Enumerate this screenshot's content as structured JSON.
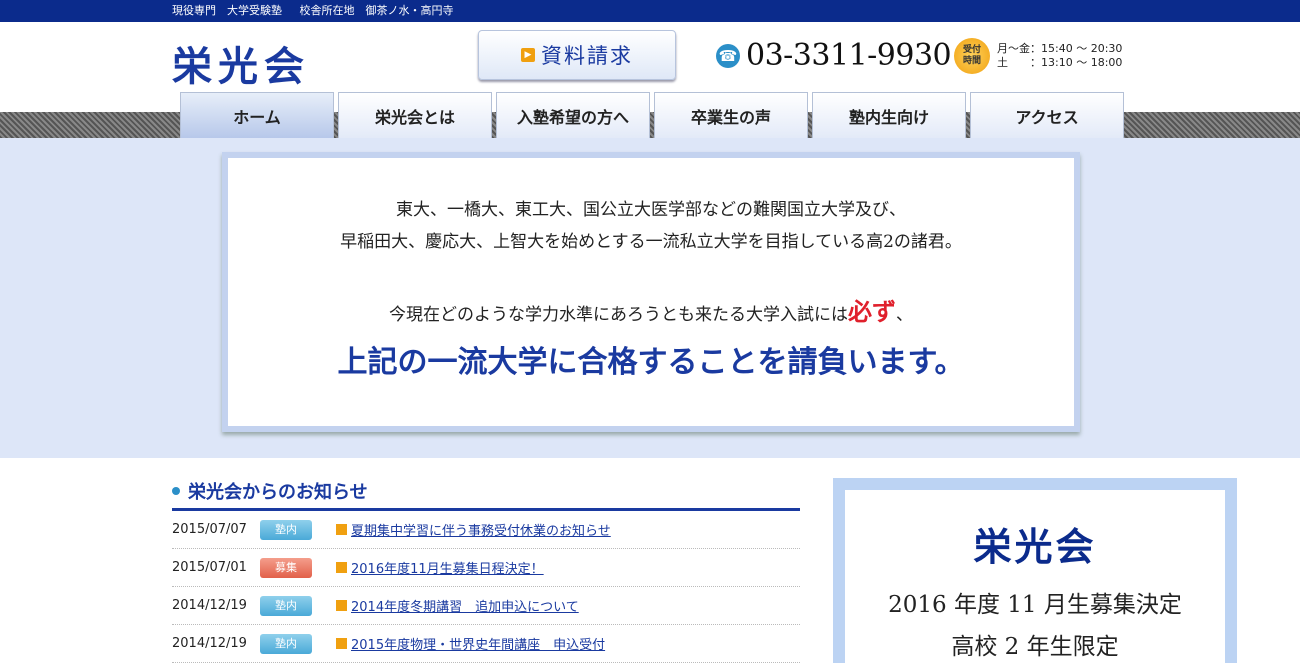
{
  "topbar": {
    "tag1": "現役専門　大学受験塾",
    "tag2": "校舎所在地　御茶ノ水・高円寺"
  },
  "header": {
    "logo": "栄光会",
    "request_button": "資料請求",
    "phone": "03-3311-9930",
    "badge_line1": "受付",
    "badge_line2": "時間",
    "hours_weekday": "月〜金：15:40 〜 20:30",
    "hours_sat": "土　　：13:10 〜 18:00"
  },
  "nav": {
    "items": [
      {
        "label": "ホーム"
      },
      {
        "label": "栄光会とは"
      },
      {
        "label": "入塾希望の方へ"
      },
      {
        "label": "卒業生の声"
      },
      {
        "label": "塾内生向け"
      },
      {
        "label": "アクセス"
      }
    ]
  },
  "hero": {
    "line1": "東大、一橋大、東工大、国公立大医学部などの難関国立大学及び、",
    "line2": "早稲田大、慶応大、上智大を始めとする一流私立大学を目指している高2の諸君。",
    "line3_pre": "今現在どのような学力水準にあろうとも来たる大学入試には",
    "line3_red": "必ず",
    "line3_post": "、",
    "line4": "上記の一流大学に合格することを請負います。"
  },
  "news": {
    "title": "栄光会からのお知らせ",
    "rows": [
      {
        "date": "2015/07/07",
        "tag": "塾内",
        "title": "夏期集中学習に伴う事務受付休業のお知らせ"
      },
      {
        "date": "2015/07/01",
        "tag": "募集",
        "title": "2016年度11月生募集日程決定！"
      },
      {
        "date": "2014/12/19",
        "tag": "塾内",
        "title": "2014年度冬期講習　追加申込について"
      },
      {
        "date": "2014/12/19",
        "tag": "塾内",
        "title": "2015年度物理・世界史年間講座　申込受付"
      }
    ]
  },
  "side": {
    "name": "栄光会",
    "line1": "2016 年度 11 月生募集決定",
    "line2": "高校 2 年生限定"
  },
  "colors": {
    "brand": "#1a3aa0",
    "topbar": "#0b2b8c",
    "accent": "#f0a010",
    "red": "#e0202c"
  }
}
